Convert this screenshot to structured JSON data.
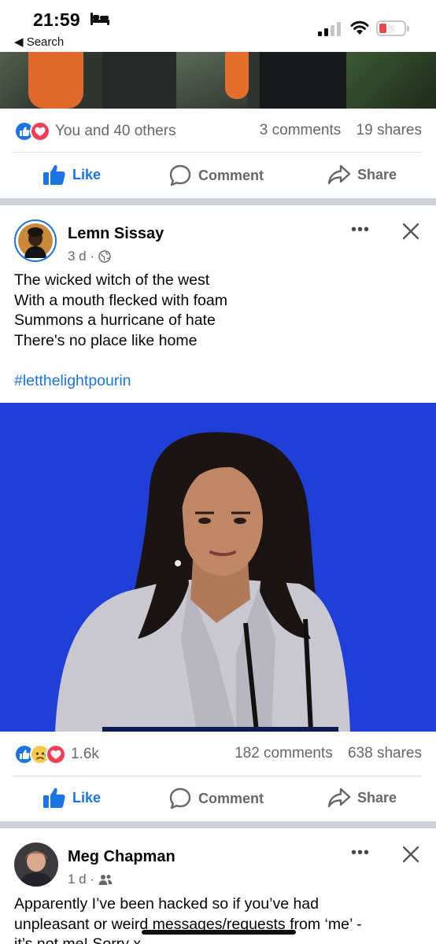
{
  "status_bar": {
    "time": "21:59",
    "back_label": "◀ Search",
    "battery": "8"
  },
  "post1_footer": {
    "reactions_text": "You and 40 others",
    "comments": "3 comments",
    "shares": "19 shares"
  },
  "actions": {
    "like": "Like",
    "comment": "Comment",
    "share": "Share"
  },
  "post2": {
    "author": "Lemn Sissay",
    "time": "3 d ·",
    "lines": [
      "The wicked witch of the west",
      "With a mouth flecked with foam",
      "Summons a hurricane of hate",
      "There's no place like home"
    ],
    "hashtag": "#letthelightpourin",
    "reactions_count": "1.6k",
    "comments": "182 comments",
    "shares": "638 shares"
  },
  "post3": {
    "author": "Meg Chapman",
    "time": "1 d ·",
    "lines": [
      "Apparently I’ve been hacked so if you’ve had",
      "unpleasant or weird messages/requests from ‘me’ -",
      "it’s not me! Sorry x"
    ]
  },
  "colors": {
    "facebook_blue": "#1b74e4",
    "love_red": "#f33e58",
    "secondary_text": "#65676b",
    "image_background": "#1f3fd7"
  }
}
